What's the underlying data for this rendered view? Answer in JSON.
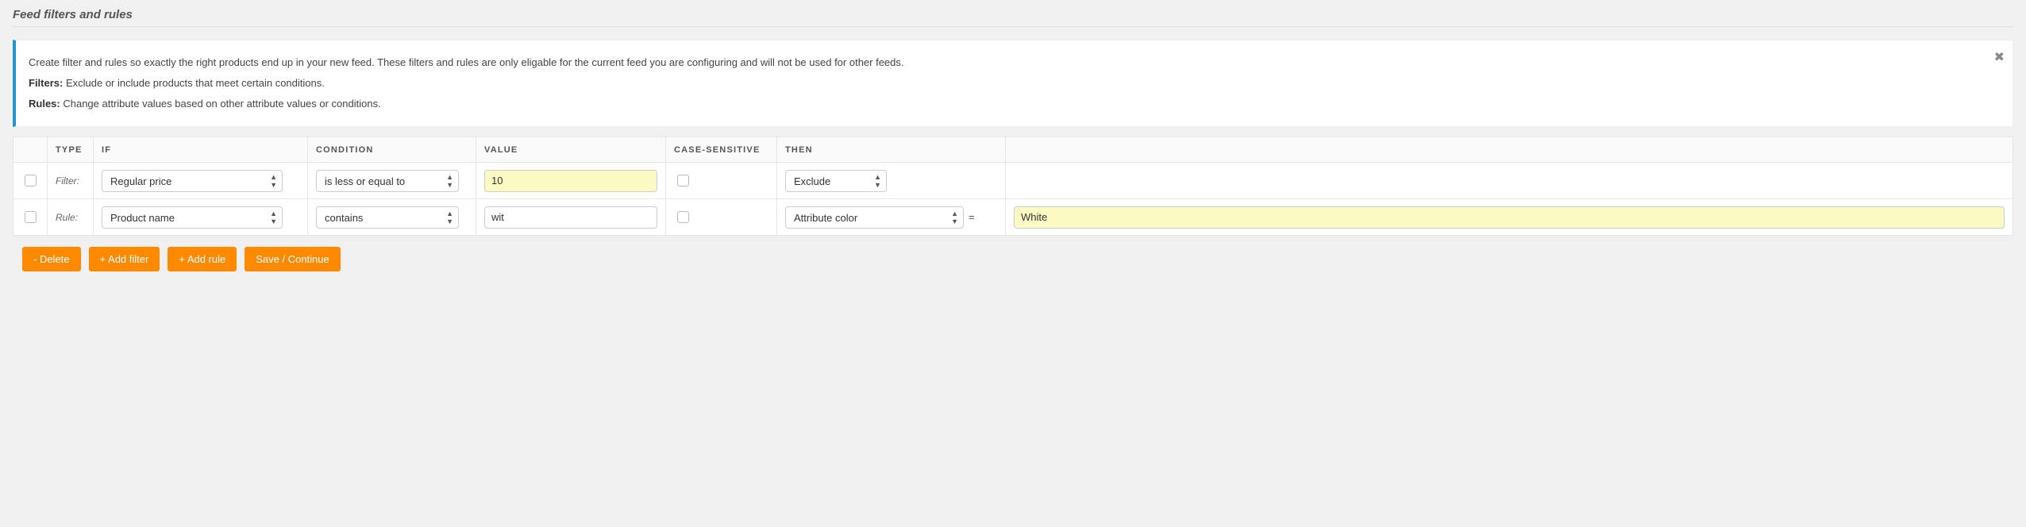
{
  "section_title": "Feed filters and rules",
  "notice": {
    "intro": "Create filter and rules so exactly the right products end up in your new feed. These filters and rules are only eligable for the current feed you are configuring and will not be used for other feeds.",
    "filters_label": "Filters:",
    "filters_text": " Exclude or include products that meet certain conditions.",
    "rules_label": "Rules:",
    "rules_text": " Change attribute values based on other attribute values or conditions."
  },
  "headers": {
    "type": "TYPE",
    "if": "IF",
    "condition": "CONDITION",
    "value": "VALUE",
    "case_sensitive": "CASE-SENSITIVE",
    "then": "THEN"
  },
  "rows": [
    {
      "type_label": "Filter:",
      "if": "Regular price",
      "condition": "is less or equal to",
      "value": "10",
      "value_highlight": true,
      "then": "Exclude",
      "then_width": "sw-130"
    },
    {
      "type_label": "Rule:",
      "if": "Product name",
      "condition": "contains",
      "value": "wit",
      "value_highlight": false,
      "then": "Attribute color",
      "then_width": "sw-225",
      "eq": "=",
      "target": "White",
      "target_highlight": true
    }
  ],
  "buttons": {
    "delete": "- Delete",
    "add_filter": "+ Add filter",
    "add_rule": "+ Add rule",
    "save": "Save / Continue"
  }
}
